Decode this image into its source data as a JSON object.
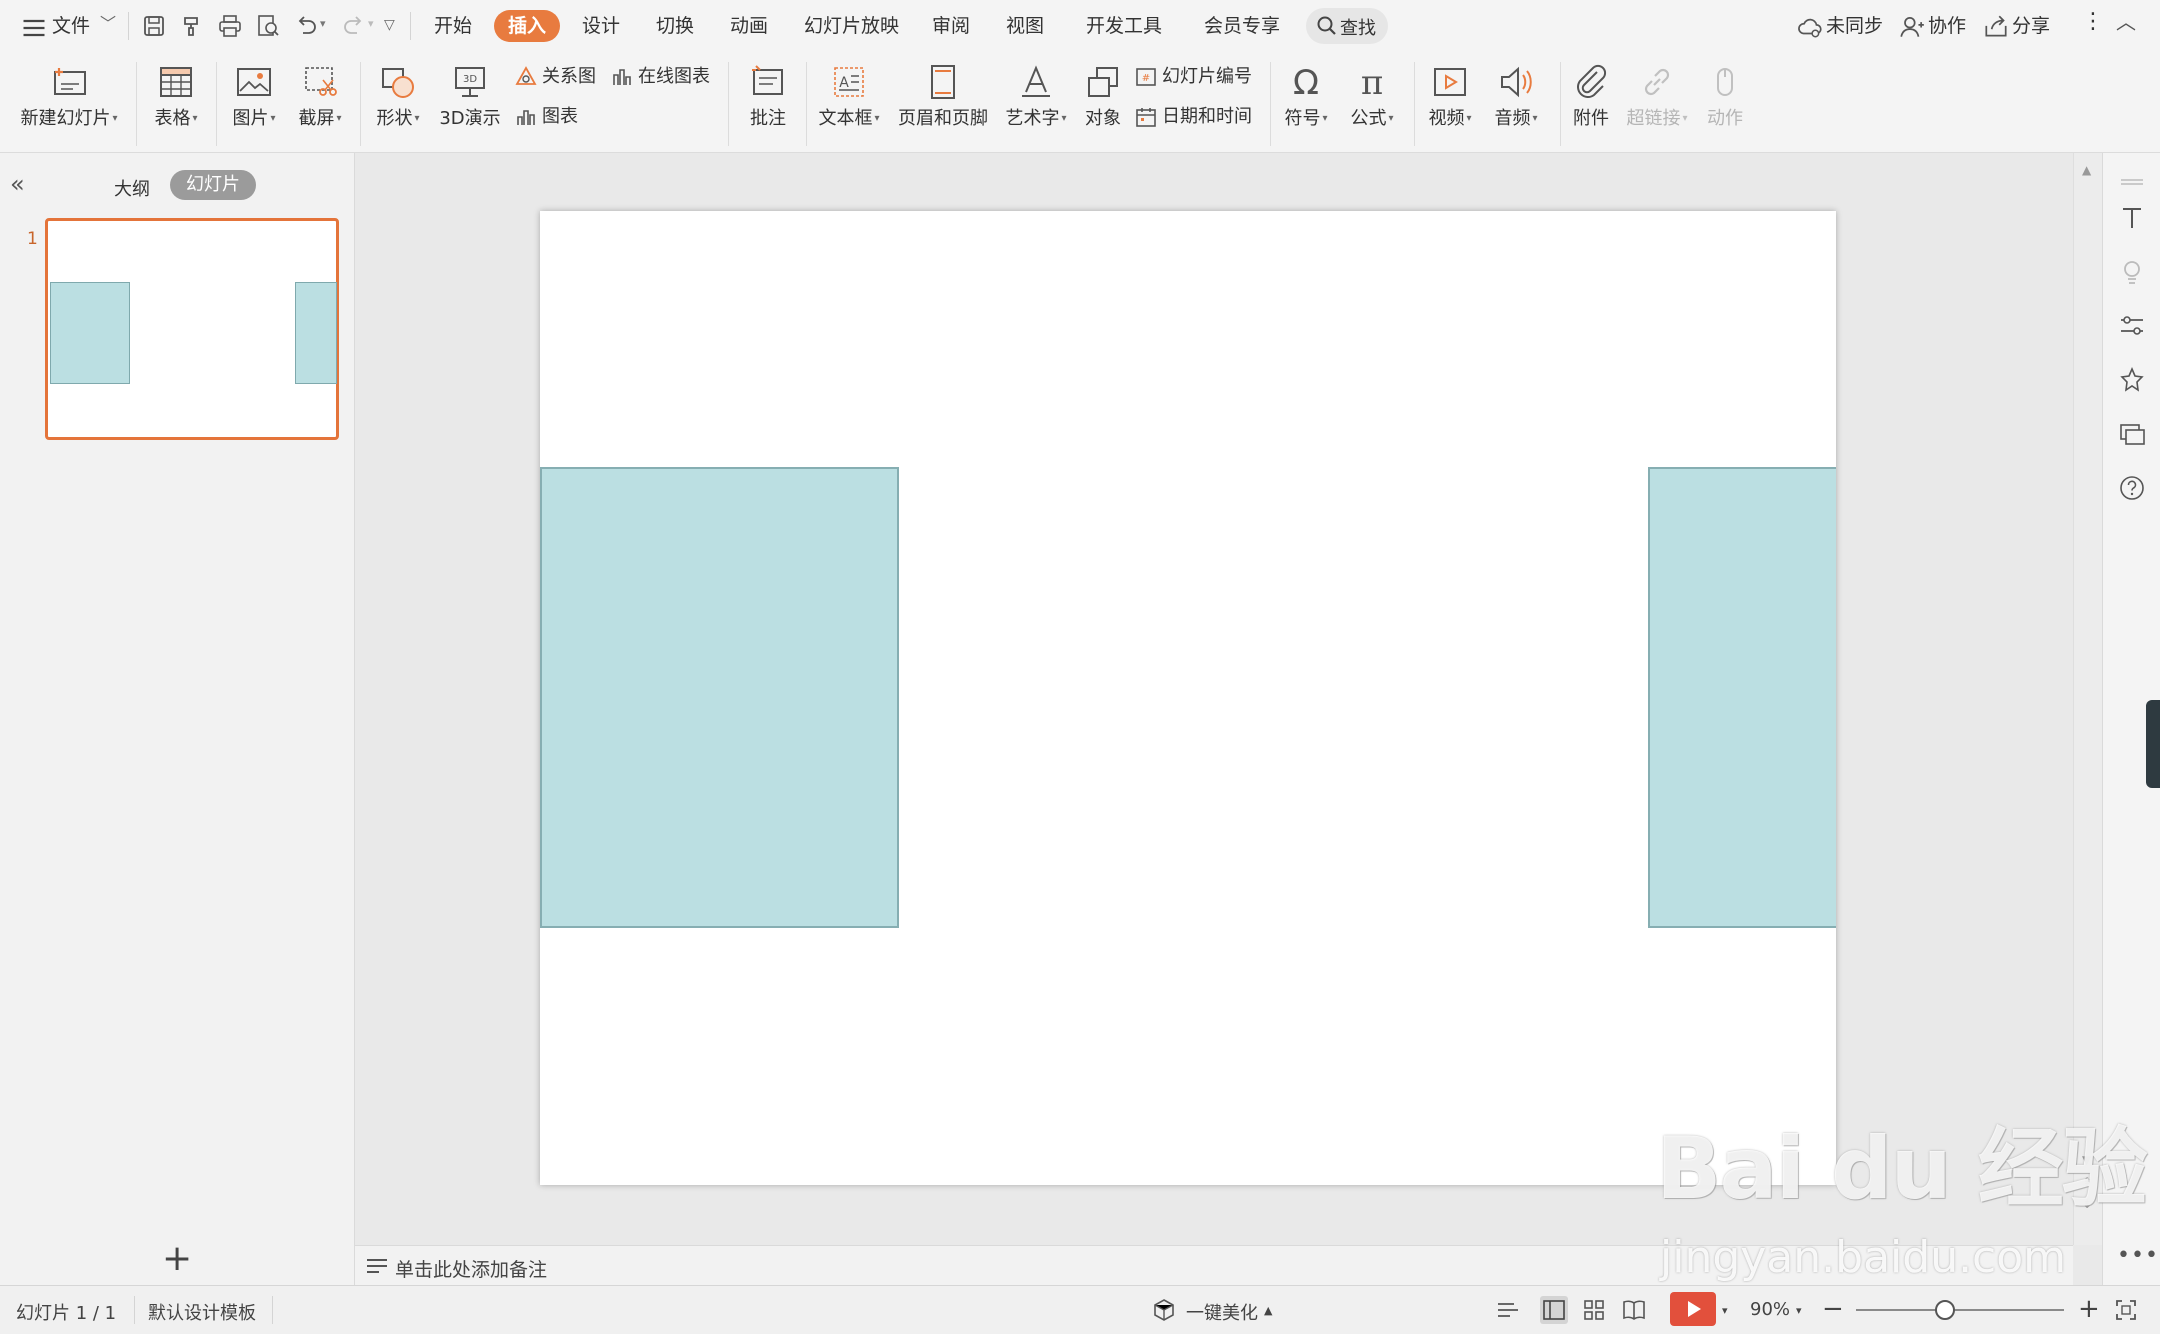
{
  "menubar": {
    "file_menu": "文件",
    "tabs": [
      {
        "label": "开始"
      },
      {
        "label": "插入",
        "active": true
      },
      {
        "label": "设计"
      },
      {
        "label": "切换"
      },
      {
        "label": "动画"
      },
      {
        "label": "幻灯片放映"
      },
      {
        "label": "审阅"
      },
      {
        "label": "视图"
      },
      {
        "label": "开发工具"
      },
      {
        "label": "会员专享"
      }
    ],
    "search_label": "查找",
    "sync_label": "未同步",
    "collab_label": "协作",
    "share_label": "分享",
    "accent_color": "#e87b3f"
  },
  "ribbon": {
    "new_slide": "新建幻灯片",
    "table": "表格",
    "picture": "图片",
    "screenshot": "截屏",
    "shape": "形状",
    "demo3d": "3D演示",
    "smartart": "关系图",
    "online_chart": "在线图表",
    "chart": "图表",
    "comment": "批注",
    "textbox": "文本框",
    "header_footer": "页眉和页脚",
    "wordart": "艺术字",
    "object": "对象",
    "slide_number": "幻灯片编号",
    "date_time": "日期和时间",
    "symbol": "符号",
    "formula": "公式",
    "video": "视频",
    "audio": "音频",
    "attachment": "附件",
    "hyperlink": "超链接",
    "action": "动作"
  },
  "left_panel": {
    "tab_outline": "大纲",
    "tab_slides": "幻灯片",
    "thumbnail_number": "1",
    "add_slide": "+"
  },
  "slide": {
    "shape_fill": "#bbdfe2",
    "shape_border": "#86aeb2"
  },
  "notes": {
    "placeholder": "单击此处添加备注"
  },
  "statusbar": {
    "slide_counter": "幻灯片 1 / 1",
    "template": "默认设计模板",
    "beautify": "一键美化",
    "zoom": "90%",
    "zoom_minus": "−",
    "zoom_plus": "+"
  },
  "watermark": {
    "logo_text": "Bai du 经验",
    "url": "jingyan.baidu.com"
  }
}
